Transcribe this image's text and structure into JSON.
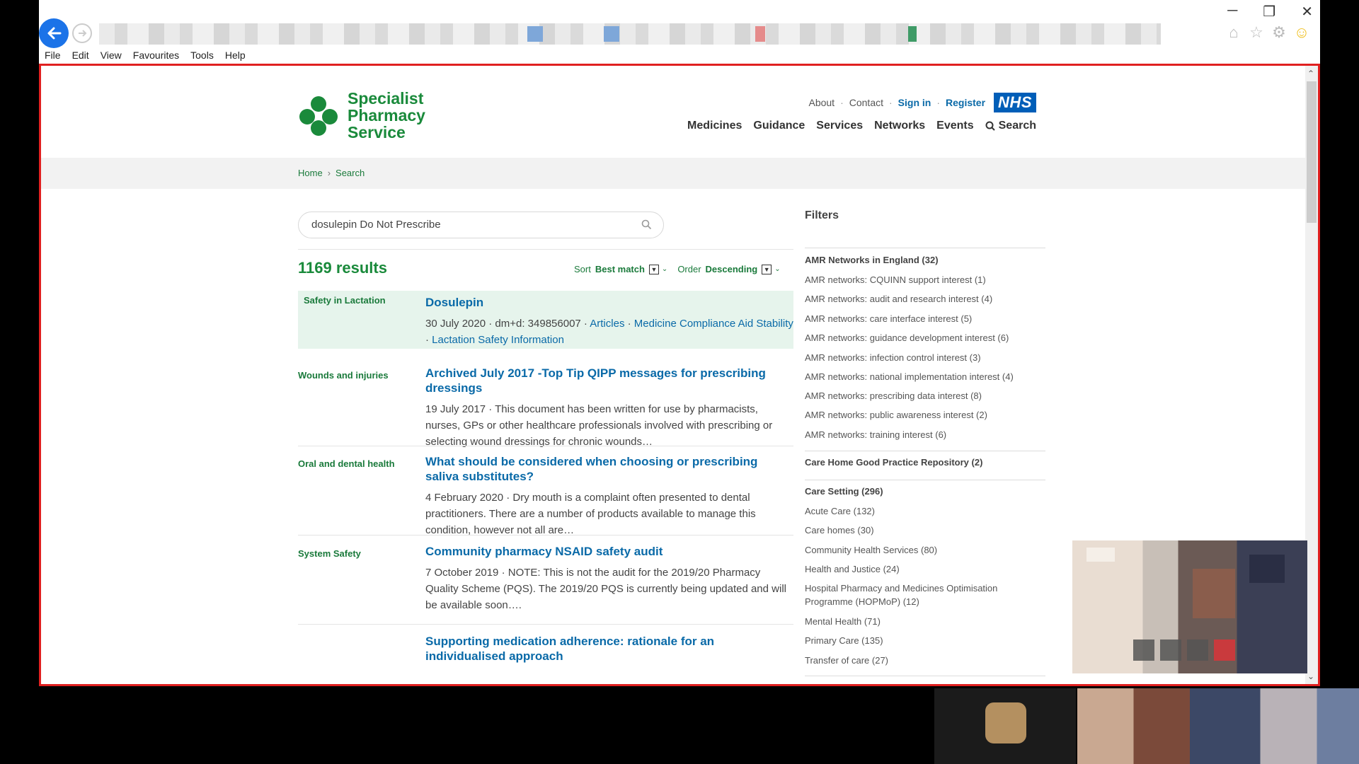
{
  "browser": {
    "menu": [
      "File",
      "Edit",
      "View",
      "Favourites",
      "Tools",
      "Help"
    ],
    "icons": [
      "back-arrow-icon",
      "forward-arrow-icon",
      "home-icon",
      "star-icon",
      "gear-icon",
      "smiley-icon"
    ],
    "window_controls": [
      "minimize",
      "restore",
      "close"
    ]
  },
  "site": {
    "logo_lines": [
      "Specialist",
      "Pharmacy",
      "Service"
    ],
    "top_links": {
      "about": "About",
      "contact": "Contact",
      "sign_in": "Sign in",
      "register": "Register",
      "nhs": "NHS"
    },
    "nav": [
      "Medicines",
      "Guidance",
      "Services",
      "Networks",
      "Events",
      "Search"
    ],
    "breadcrumb": {
      "home": "Home",
      "current": "Search"
    },
    "brand_green": "#1a8a3b",
    "link_blue": "#0a6aa8"
  },
  "search": {
    "query": "dosulepin Do Not Prescribe",
    "results_count": "1169 results",
    "sort_label": "Sort",
    "sort_value": "Best match",
    "order_label": "Order",
    "order_value": "Descending"
  },
  "results": [
    {
      "category": "Safety in Lactation",
      "title": "Dosulepin",
      "meta": "30 July 2020 · dm+d: 349856007 · ",
      "links": [
        "Articles",
        "Medicine Compliance Aid Stability",
        "Lactation Safety Information"
      ]
    },
    {
      "category": "Wounds and injuries",
      "title": "Archived July 2017 -Top Tip QIPP messages for prescribing dressings",
      "desc": "19 July 2017 · This document has been written for use by pharmacists, nurses, GPs or other healthcare professionals involved with prescribing or selecting wound dressings for chronic wounds…"
    },
    {
      "category": "Oral and dental health",
      "title": "What should be considered when choosing or prescribing saliva substitutes?",
      "desc": "4 February 2020 · Dry mouth is a complaint often presented to dental practitioners. There are a number of products available to manage this condition, however not all are…"
    },
    {
      "category": "System Safety",
      "title": "Community pharmacy NSAID safety audit",
      "desc": "7 October 2019 · NOTE: This is not the audit for the 2019/20 Pharmacy Quality Scheme (PQS). The 2019/20 PQS is currently being updated and will be available soon…."
    },
    {
      "category": "",
      "title": "Supporting medication adherence: rationale for an individualised approach",
      "desc": ""
    }
  ],
  "filters": {
    "title": "Filters",
    "groups": [
      {
        "title": "AMR Networks in England (32)",
        "items": [
          "AMR networks: CQUINN support interest (1)",
          "AMR networks: audit and research interest (4)",
          "AMR networks: care interface interest (5)",
          "AMR networks: guidance development interest (6)",
          "AMR networks: infection control interest (3)",
          "AMR networks: national implementation interest (4)",
          "AMR networks: prescribing data interest (8)",
          "AMR networks: public awareness interest (2)",
          "AMR networks: training interest (6)"
        ]
      },
      {
        "title": "Care Home Good Practice Repository (2)",
        "items": []
      },
      {
        "title": "Care Setting (296)",
        "items": [
          "Acute Care (132)",
          "Care homes (30)",
          "Community Health Services (80)",
          "Health and Justice (24)",
          "Hospital Pharmacy and Medicines Optimisation Programme (HOPMoP) (12)",
          "Mental Health (71)",
          "Primary Care (135)",
          "Transfer of care (27)"
        ]
      }
    ]
  }
}
